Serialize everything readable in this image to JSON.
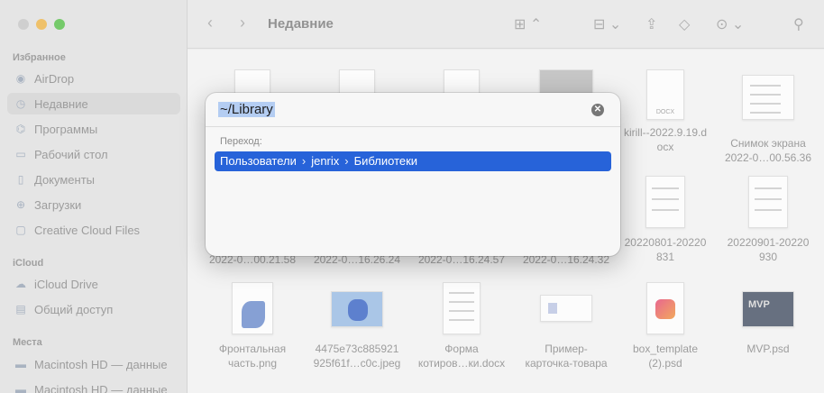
{
  "sidebar": {
    "traffic_colors": [
      "#c9c9c9",
      "#f0b84e",
      "#5bc24e"
    ],
    "favorites_title": "Избранное",
    "favorites": [
      {
        "label": "AirDrop",
        "icon": "airdrop-icon"
      },
      {
        "label": "Недавние",
        "icon": "clock-icon",
        "active": true
      },
      {
        "label": "Программы",
        "icon": "apps-icon"
      },
      {
        "label": "Рабочий стол",
        "icon": "desktop-icon"
      },
      {
        "label": "Документы",
        "icon": "document-icon"
      },
      {
        "label": "Загрузки",
        "icon": "download-icon"
      },
      {
        "label": "Creative Cloud Files",
        "icon": "file-icon"
      }
    ],
    "icloud_title": "iCloud",
    "icloud": [
      {
        "label": "iCloud Drive",
        "icon": "cloud-icon"
      },
      {
        "label": "Общий доступ",
        "icon": "shared-folder-icon"
      }
    ],
    "places_title": "Места",
    "places": [
      {
        "label": "Macintosh HD — данные",
        "icon": "disk-icon"
      },
      {
        "label": "Macintosh HD — данные",
        "icon": "disk-icon"
      }
    ]
  },
  "toolbar": {
    "title": "Недавние"
  },
  "files_row1": [
    {
      "line1": "",
      "line2": ""
    },
    {
      "line1": "",
      "line2": ""
    },
    {
      "line1": "",
      "line2": ""
    },
    {
      "line1": "",
      "line2": ""
    },
    {
      "line1": "kirill--2022.9.19.d",
      "line2": "ocx"
    },
    {
      "line1": "Снимок экрана",
      "line2": "2022-0…00.56.36"
    }
  ],
  "files_row2": [
    {
      "line1": "2022-0…00.21.58",
      "line2": ""
    },
    {
      "line1": "2022-0…16.26.24",
      "line2": ""
    },
    {
      "line1": "2022-0…16.24.57",
      "line2": ""
    },
    {
      "line1": "2022-0…16.24.32",
      "line2": ""
    },
    {
      "line1": "20220801-20220",
      "line2": "831"
    },
    {
      "line1": "20220901-20220",
      "line2": "930"
    }
  ],
  "files_row3": [
    {
      "line1": "Фронтальная",
      "line2": "часть.png"
    },
    {
      "line1": "4475e73c885921",
      "line2": "925f61f…c0c.jpeg"
    },
    {
      "line1": "Форма",
      "line2": "котиров…ки.docx"
    },
    {
      "line1": "Пример-",
      "line2": "карточка-товара"
    },
    {
      "line1": "box_template",
      "line2": "(2).psd"
    },
    {
      "line1": "MVP.psd",
      "line2": ""
    }
  ],
  "dialog": {
    "path_value": "~/Library",
    "goto_label": "Переход:",
    "suggestion": [
      "Пользователи",
      "jenrix",
      "Библиотеки"
    ],
    "separator": "›",
    "clear_symbol": "✕"
  }
}
